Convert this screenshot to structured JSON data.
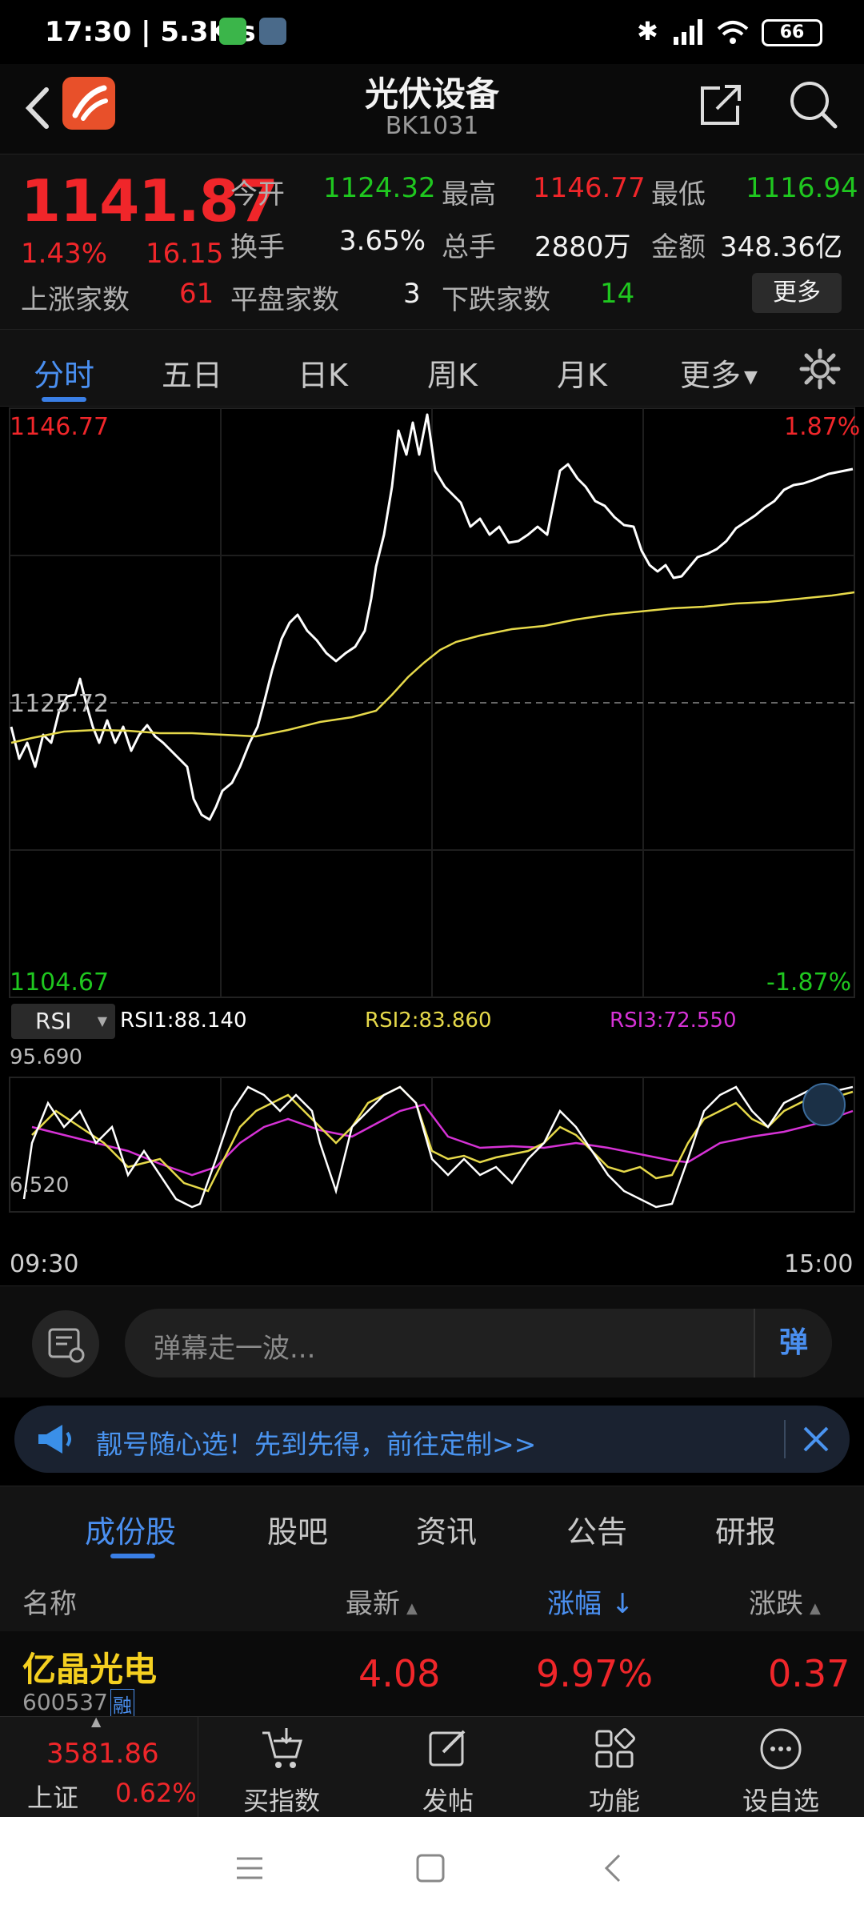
{
  "status": {
    "time": "17:30",
    "speed": "5.3K/s",
    "battery": "66"
  },
  "header": {
    "title": "光伏设备",
    "code": "BK1031"
  },
  "quote": {
    "price": "1141.87",
    "change_pct": "1.43%",
    "change": "16.15",
    "open_label": "今开",
    "open": "1124.32",
    "high_label": "最高",
    "high": "1146.77",
    "low_label": "最低",
    "low": "1116.94",
    "turnover_label": "换手",
    "turnover": "3.65%",
    "volume_label": "总手",
    "volume": "2880万",
    "amount_label": "金额",
    "amount": "348.36亿",
    "up_label": "上涨家数",
    "up": "61",
    "flat_label": "平盘家数",
    "flat": "3",
    "down_label": "下跌家数",
    "down": "14",
    "more": "更多"
  },
  "tabs": [
    "分时",
    "五日",
    "日K",
    "周K",
    "月K",
    "更多"
  ],
  "chart": {
    "top_price": "1146.77",
    "mid_price": "1125.72",
    "bottom_price": "1104.67",
    "top_pct": "1.87%",
    "bottom_pct": "-1.87%",
    "rsi_select": "RSI",
    "rsi1": "RSI1:88.140",
    "rsi2": "RSI2:83.860",
    "rsi3": "RSI3:72.550",
    "rsi_max": "95.690",
    "rsi_min": "6.520",
    "time_start": "09:30",
    "time_end": "15:00",
    "colors": {
      "price": "#ffffff",
      "avg": "#e6d94a",
      "rsi1": "#ffffff",
      "rsi2": "#e6d94a",
      "rsi3": "#d632d6"
    }
  },
  "danmaku": {
    "placeholder": "弹幕走一波...",
    "send_icon": "弹"
  },
  "notice": {
    "text": "靓号随心选！先到先得，前往定制>>"
  },
  "subtabs": [
    "成份股",
    "股吧",
    "资讯",
    "公告",
    "研报"
  ],
  "table": {
    "headers": [
      "名称",
      "最新",
      "涨幅",
      "涨跌"
    ],
    "rows": [
      {
        "name": "亿晶光电",
        "code": "600537",
        "tag": "融",
        "last": "4.08",
        "pct": "9.97%",
        "chg": "0.37"
      }
    ]
  },
  "bottomnav": {
    "index_value": "3581.86",
    "index_name": "上证",
    "index_pct": "0.62%",
    "items": [
      "买指数",
      "发帖",
      "功能",
      "设自选"
    ]
  }
}
